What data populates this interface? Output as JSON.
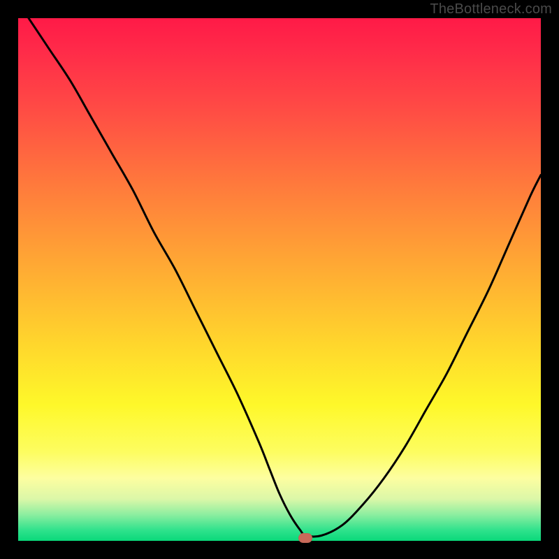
{
  "watermark": {
    "text": "TheBottleneck.com"
  },
  "chart_data": {
    "type": "line",
    "title": "",
    "xlabel": "",
    "ylabel": "",
    "xlim": [
      0,
      100
    ],
    "ylim": [
      0,
      100
    ],
    "grid": false,
    "legend": false,
    "series": [
      {
        "name": "bottleneck-curve",
        "x": [
          2,
          6,
          10,
          14,
          18,
          22,
          26,
          30,
          34,
          38,
          42,
          46,
          48,
          50,
          52,
          54,
          55,
          58,
          62,
          66,
          70,
          74,
          78,
          82,
          86,
          90,
          94,
          98,
          100
        ],
        "y": [
          100,
          94,
          88,
          81,
          74,
          67,
          59,
          52,
          44,
          36,
          28,
          19,
          14,
          9,
          5,
          2,
          1,
          1,
          3,
          7,
          12,
          18,
          25,
          32,
          40,
          48,
          57,
          66,
          70
        ]
      }
    ],
    "marker": {
      "x": 55,
      "y": 0.5,
      "color": "#c96a5a"
    },
    "background_gradient": {
      "stops": [
        {
          "pos": 0.0,
          "color": "#ff1a47"
        },
        {
          "pos": 0.32,
          "color": "#ff7a3c"
        },
        {
          "pos": 0.63,
          "color": "#ffd82c"
        },
        {
          "pos": 0.88,
          "color": "#fdfea0"
        },
        {
          "pos": 1.0,
          "color": "#0ad87a"
        }
      ]
    }
  }
}
